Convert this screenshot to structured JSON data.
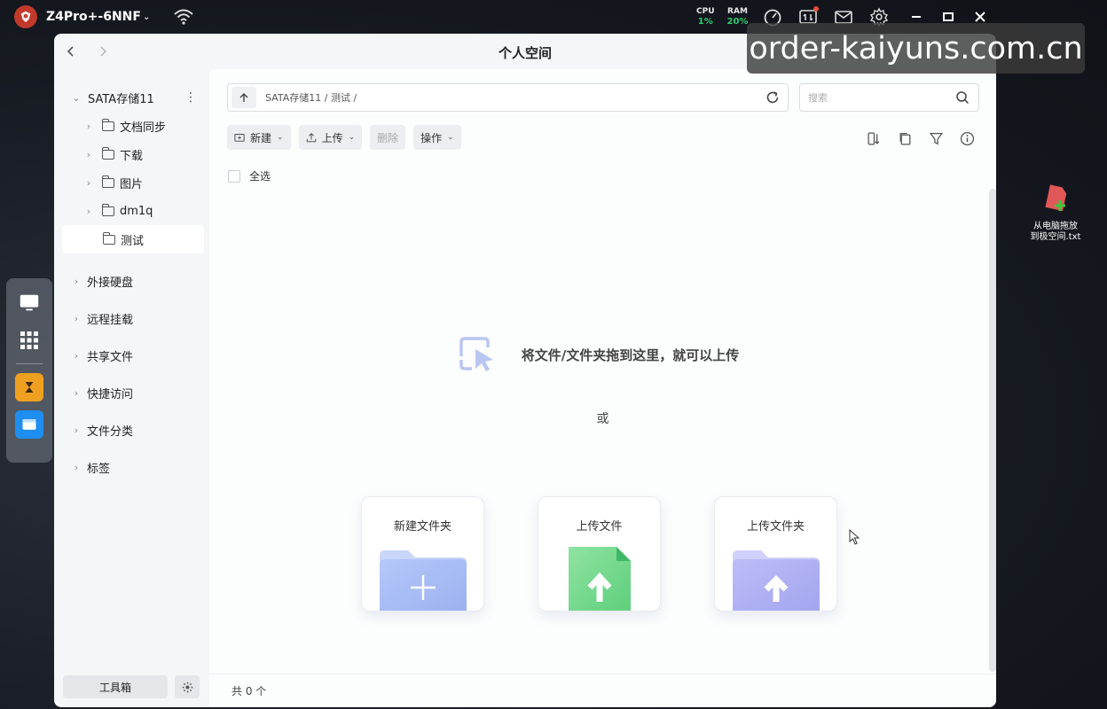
{
  "topbar": {
    "device_name": "Z4Pro+-6NNF",
    "cpu_label": "CPU",
    "cpu_value": "1%",
    "ram_label": "RAM",
    "ram_value": "20%"
  },
  "window": {
    "title": "个人空间"
  },
  "sidebar": {
    "root": "SATA存储11",
    "children": [
      "文档同步",
      "下载",
      "图片",
      "dm1q",
      "测试"
    ],
    "active_child": "测试",
    "sections": [
      "外接硬盘",
      "远程挂载",
      "共享文件",
      "快捷访问",
      "文件分类",
      "标签"
    ],
    "toolbox_label": "工具箱"
  },
  "main": {
    "path": "SATA存储11 / 测试 /",
    "search_placeholder": "搜索",
    "actions": {
      "new": "新建",
      "upload": "上传",
      "delete": "删除",
      "operate": "操作"
    },
    "select_all": "全选",
    "drop_hint": "将文件/文件夹拖到这里，就可以上传",
    "or": "或",
    "cards": [
      "新建文件夹",
      "上传文件",
      "上传文件夹"
    ],
    "status": "共 0 个"
  },
  "watermark": "order-kaiyuns.com.cn",
  "desktop_file": {
    "name_line1": "从电脑拖放",
    "name_line2": "到极空间.txt"
  },
  "colors": {
    "accent_green": "#2ecc71",
    "folder_blue": "#a9bff5",
    "file_green": "#6fd88a",
    "folder_violet": "#aeb0f3"
  }
}
